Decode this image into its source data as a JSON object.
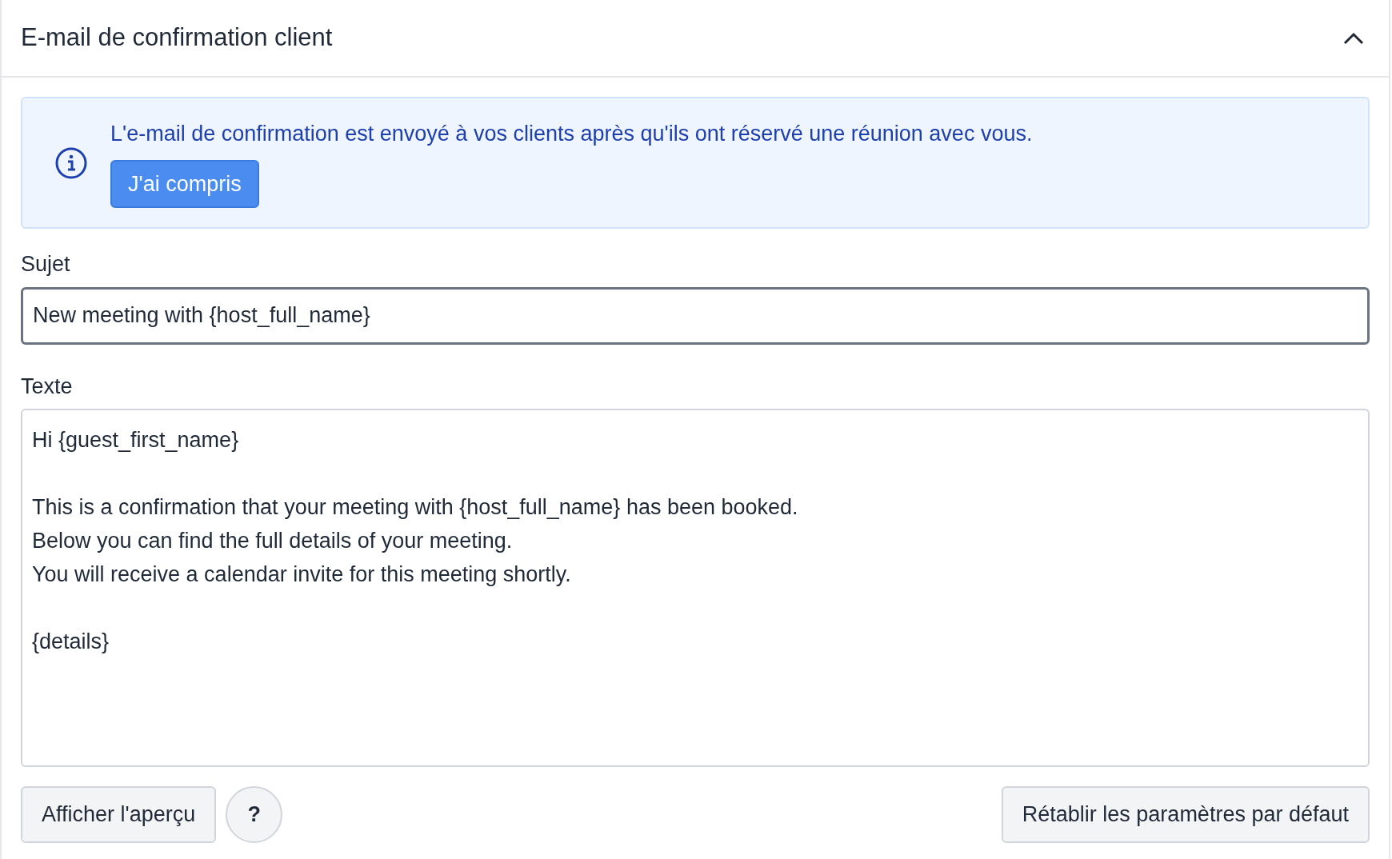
{
  "panel": {
    "title": "E-mail de confirmation client",
    "expanded": true
  },
  "notice": {
    "text": "L'e-mail de confirmation est envoyé à vos clients après qu'ils ont réservé une réunion avec vous.",
    "button": "J'ai compris"
  },
  "subject": {
    "label": "Sujet",
    "value": "New meeting with {host_full_name}"
  },
  "body": {
    "label": "Texte",
    "value": "Hi {guest_first_name}\n\nThis is a confirmation that your meeting with {host_full_name} has been booked.\nBelow you can find the full details of your meeting.\nYou will receive a calendar invite for this meeting shortly.\n\n{details}"
  },
  "buttons": {
    "preview": "Afficher l'aperçu",
    "help": "?",
    "reset": "Rétablir les paramètres par défaut"
  }
}
